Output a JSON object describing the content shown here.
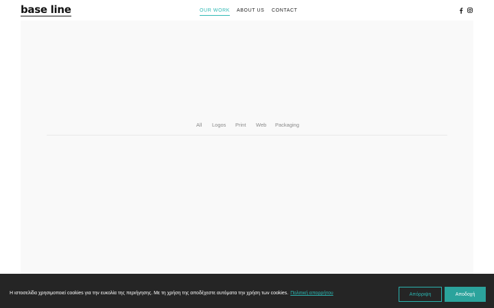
{
  "header": {
    "logo": "base line",
    "nav": [
      {
        "label": "OUR WORK",
        "active": true
      },
      {
        "label": "ABOUT US",
        "active": false
      },
      {
        "label": "CONTACT",
        "active": false
      }
    ],
    "social": [
      "facebook-icon",
      "instagram-icon"
    ]
  },
  "portfolio": {
    "filters": [
      "All",
      "Logos",
      "Print",
      "Web",
      "Packaging"
    ]
  },
  "cookie_bar": {
    "message": "Η ιστοσελίδα χρησιμοποιεί cookies για την ευκολία της περιήγησης. Με τη χρήση της αποδέχεστε αυτόματα την χρήση των cookies.",
    "policy_link": "Πολιτική απορρήτου",
    "decline_label": "Απόρριψη",
    "accept_label": "Αποδοχή"
  },
  "colors": {
    "accent": "#2bb7b3",
    "accept_button": "#2ba39c",
    "cookie_bg": "#252525",
    "portfolio_bg": "#f9f9f9"
  }
}
